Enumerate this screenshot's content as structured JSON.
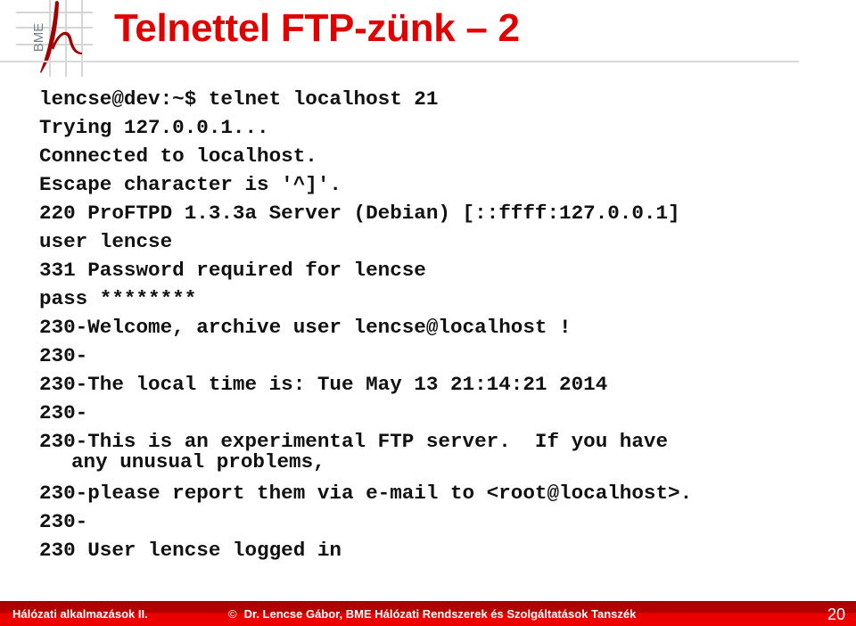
{
  "slide": {
    "title": "Telnettel FTP-zünk – 2",
    "logo": {
      "icon": "bme-logo-icon",
      "text": "BME"
    }
  },
  "transcript": {
    "lines": [
      "lencse@dev:~$ telnet localhost 21",
      "Trying 127.0.0.1...",
      "Connected to localhost.",
      "Escape character is '^]'.",
      "220 ProFTPD 1.3.3a Server (Debian) [::ffff:127.0.0.1]",
      "user lencse",
      "331 Password required for lencse",
      "pass ********",
      "230-Welcome, archive user lencse@localhost !",
      "230-",
      "230-The local time is: Tue May 13 21:14:21 2014",
      "230-",
      "230-This is an experimental FTP server.  If you have",
      "any unusual problems,",
      "230-please report them via e-mail to <root@localhost>.",
      "230-",
      "230 User lencse logged in"
    ]
  },
  "footer": {
    "course": "Hálózati alkalmazások II.",
    "copyright_symbol": "©",
    "copyright": "Dr. Lencse Gábor, BME Hálózati Rendszerek és Szolgáltatások Tanszék",
    "page_number": "20"
  },
  "colors": {
    "title": "#e10000",
    "footer_dark": "#a80000",
    "footer_bright": "#f00000",
    "logo_red": "#a00000",
    "logo_grid": "#d0d0d0"
  }
}
